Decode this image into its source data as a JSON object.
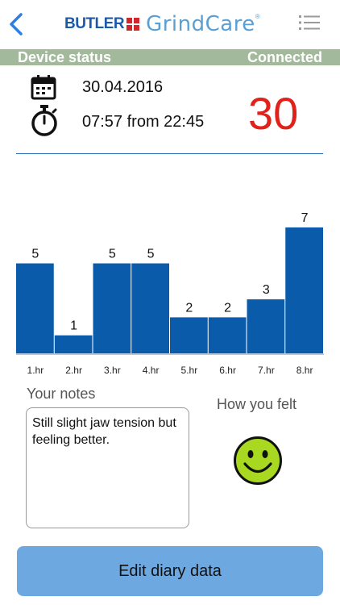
{
  "header": {
    "back_icon": "chevron-left-icon",
    "brand_primary": "BUTLER",
    "brand_secondary": "GrindCare",
    "brand_mark": "®",
    "menu_icon": "list-menu-icon"
  },
  "status": {
    "label": "Device status",
    "value": "Connected",
    "bar_color": "#a3b99c"
  },
  "session": {
    "calendar_icon": "calendar-icon",
    "timer_icon": "stopwatch-icon",
    "date": "30.04.2016",
    "time": "07:57 from 22:45",
    "score": "30",
    "score_color": "#e0221a"
  },
  "chart_data": {
    "type": "bar",
    "categories": [
      "1.hr",
      "2.hr",
      "3.hr",
      "4.hr",
      "5.hr",
      "6.hr",
      "7.hr",
      "8.hr"
    ],
    "values": [
      5,
      1,
      5,
      5,
      2,
      2,
      3,
      7
    ],
    "bar_color": "#0b5bab",
    "data_labels": true,
    "title": "",
    "xlabel": "",
    "ylabel": ""
  },
  "notes": {
    "label": "Your notes",
    "text": "Still slight jaw tension but feeling better."
  },
  "feeling": {
    "label": "How you felt",
    "icon": "smiley-face-icon",
    "color": "#a8d820"
  },
  "actions": {
    "edit_label": "Edit diary data",
    "edit_color": "#6ea8e0"
  }
}
